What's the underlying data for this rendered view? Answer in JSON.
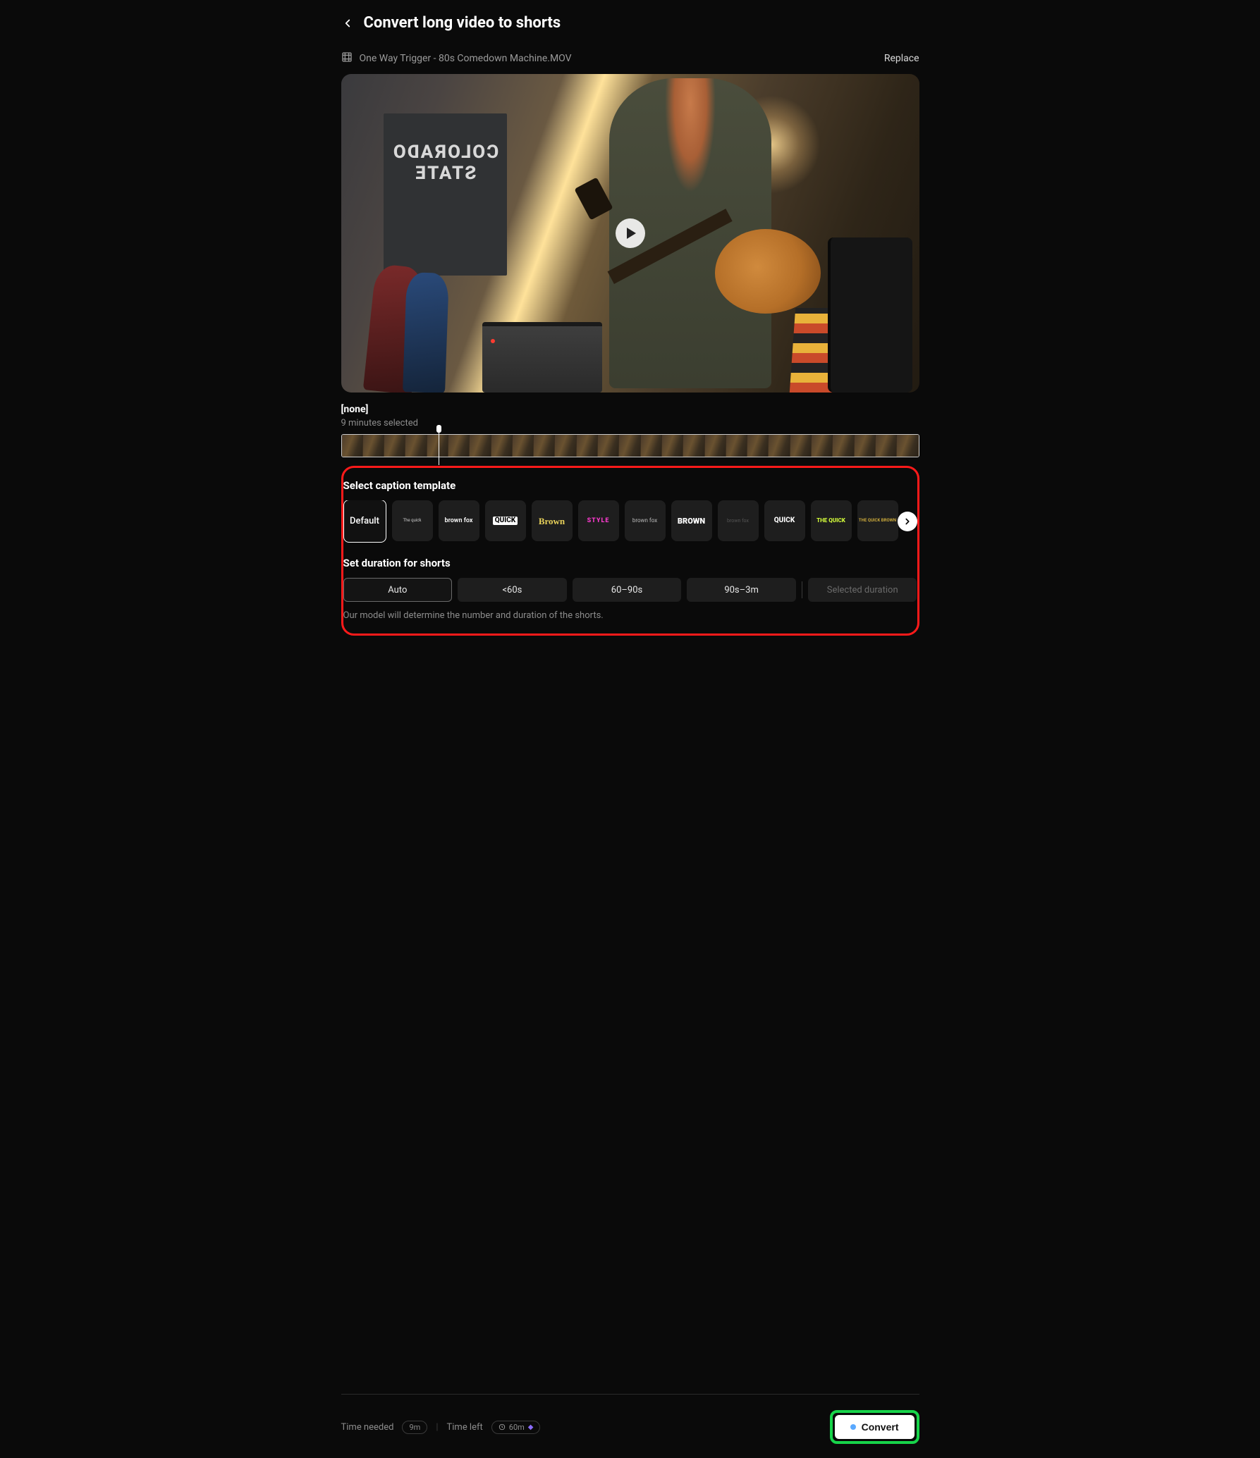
{
  "header": {
    "title": "Convert long video to shorts"
  },
  "file": {
    "name": "One Way Trigger - 80s Comedown Machine.MOV",
    "replace": "Replace"
  },
  "banner_text": "COLORADO STATE",
  "selection": {
    "label": "[none]",
    "minutes": "9 minutes selected"
  },
  "captions": {
    "title": "Select caption template",
    "templates": [
      {
        "id": "default",
        "label": "Default"
      },
      {
        "id": "t1",
        "label": "The quick",
        "style": "color:#ccc;font-size:6px;"
      },
      {
        "id": "t2",
        "label": "brown fox",
        "style": "color:#fff;font-size:9px;font-weight:600;"
      },
      {
        "id": "t3",
        "label": "QUICK",
        "style": "color:#fff;font-size:10px;font-weight:800;background:#fff;color:#000;padding:1px 3px;border-radius:2px;"
      },
      {
        "id": "t4",
        "label": "Brown",
        "style": "color:#e8d15a;font-size:13px;font-weight:800;font-family:Georgia,serif;"
      },
      {
        "id": "t5",
        "label": "STYLE",
        "style": "color:#ff3bd1;font-size:9px;font-weight:800;letter-spacing:1px;"
      },
      {
        "id": "t6",
        "label": "brown fox",
        "style": "color:#bbb;font-size:8px;"
      },
      {
        "id": "t7",
        "label": "BROWN",
        "style": "color:#fff;font-size:11px;font-weight:900;"
      },
      {
        "id": "t8",
        "label": "brown fox",
        "style": "color:#555;font-size:7px;"
      },
      {
        "id": "t9",
        "label": "QUICK",
        "style": "color:#fff;font-size:10px;font-weight:800;"
      },
      {
        "id": "t10",
        "label": "THE QUICK",
        "style": "color:#d6ff3b;font-size:8px;font-weight:800;"
      },
      {
        "id": "t11",
        "label": "THE QUICK BROWN",
        "style": "color:#c9a83b;font-size:6px;font-weight:700;"
      }
    ]
  },
  "duration": {
    "title": "Set duration for shorts",
    "options": {
      "auto": "Auto",
      "lt60": "<60s",
      "r6090": "60–90s",
      "r90_3m": "90s–3m",
      "selected": "Selected duration"
    },
    "hint": "Our model will determine the number and duration of the shorts."
  },
  "footer": {
    "time_needed_label": "Time needed",
    "time_needed_value": "9m",
    "time_left_label": "Time left",
    "time_left_value": "60m",
    "convert": "Convert"
  }
}
